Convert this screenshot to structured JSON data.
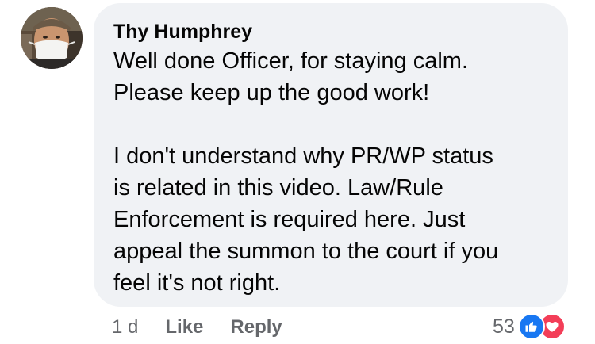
{
  "comment": {
    "author": "Thy Humphrey",
    "paragraphs": [
      {
        "lines": [
          "Well done Officer, for staying calm.",
          "Please keep up the good work!"
        ]
      },
      {
        "lines": [
          "I don't understand why PR/WP status",
          "is related in this video. Law/Rule",
          "Enforcement is required here. Just",
          "appeal the summon to the court if you",
          "feel it's not right."
        ]
      }
    ]
  },
  "meta": {
    "time": "1 d",
    "like_label": "Like",
    "reply_label": "Reply"
  },
  "reactions": {
    "count": "53",
    "icons": [
      "like-icon",
      "love-icon"
    ]
  },
  "colors": {
    "bubble": "#f0f2f5",
    "secondary_text": "#65676b",
    "like_blue": "#1877f2",
    "love_red": "#f33e58"
  }
}
